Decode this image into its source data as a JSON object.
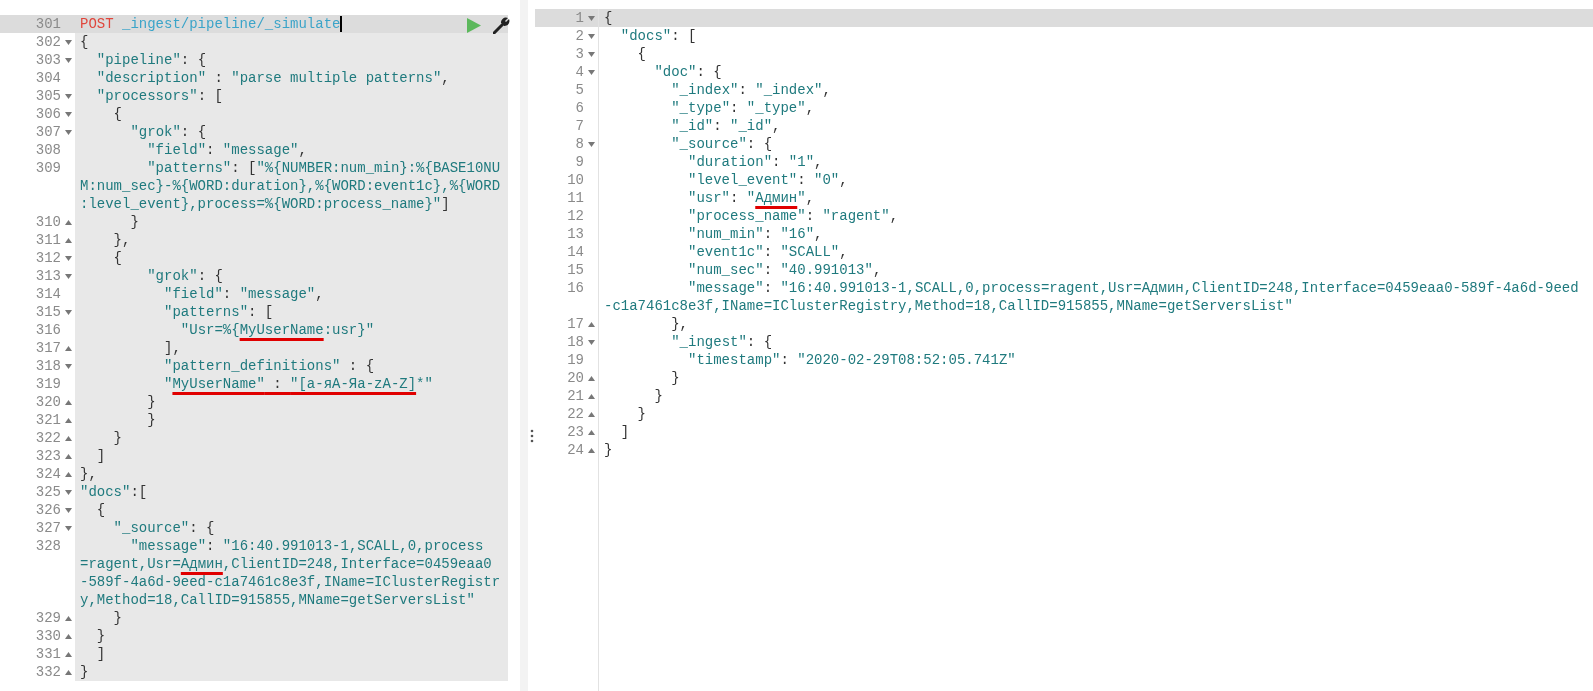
{
  "request_pane": {
    "lines": [
      {
        "number": "301",
        "kind": "request",
        "fold_start": false,
        "fold_end": false,
        "active": true,
        "method": "POST",
        "path": "_ingest/pipeline/_simulate"
      },
      {
        "number": "302",
        "kind": "code",
        "fold_start": true,
        "fold_end": false,
        "active": false,
        "rows": [
          "{"
        ]
      },
      {
        "number": "303",
        "kind": "code",
        "fold_start": true,
        "fold_end": false,
        "active": false,
        "rows": [
          "  \"pipeline\": {"
        ]
      },
      {
        "number": "304",
        "kind": "code",
        "fold_start": false,
        "fold_end": false,
        "active": false,
        "rows": [
          "  \"description\" : \"parse multiple patterns\","
        ]
      },
      {
        "number": "305",
        "kind": "code",
        "fold_start": true,
        "fold_end": false,
        "active": false,
        "rows": [
          "  \"processors\": ["
        ]
      },
      {
        "number": "306",
        "kind": "code",
        "fold_start": true,
        "fold_end": false,
        "active": false,
        "rows": [
          "    {"
        ]
      },
      {
        "number": "307",
        "kind": "code",
        "fold_start": true,
        "fold_end": false,
        "active": false,
        "rows": [
          "      \"grok\": {"
        ]
      },
      {
        "number": "308",
        "kind": "code",
        "fold_start": false,
        "fold_end": false,
        "active": false,
        "rows": [
          "        \"field\": \"message\","
        ]
      },
      {
        "number": "309",
        "kind": "code",
        "fold_start": false,
        "fold_end": false,
        "active": false,
        "rows": [
          "        \"patterns\": [\"%{NUMBER:num_min}:%{BASE10NU",
          "M:num_sec}-%{WORD:duration},%{WORD:event1c},%{WORD",
          ":level_event},process=%{WORD:process_name}\"]"
        ]
      },
      {
        "number": "310",
        "kind": "code",
        "fold_start": false,
        "fold_end": true,
        "active": false,
        "rows": [
          "      }"
        ]
      },
      {
        "number": "311",
        "kind": "code",
        "fold_start": false,
        "fold_end": true,
        "active": false,
        "rows": [
          "    },"
        ]
      },
      {
        "number": "312",
        "kind": "code",
        "fold_start": true,
        "fold_end": false,
        "active": false,
        "rows": [
          "    {"
        ]
      },
      {
        "number": "313",
        "kind": "code",
        "fold_start": true,
        "fold_end": false,
        "active": false,
        "rows": [
          "        \"grok\": {"
        ]
      },
      {
        "number": "314",
        "kind": "code",
        "fold_start": false,
        "fold_end": false,
        "active": false,
        "rows": [
          "          \"field\": \"message\","
        ]
      },
      {
        "number": "315",
        "kind": "code",
        "fold_start": true,
        "fold_end": false,
        "active": false,
        "rows": [
          "          \"patterns\": ["
        ]
      },
      {
        "number": "316",
        "kind": "code",
        "fold_start": false,
        "fold_end": false,
        "active": false,
        "rows": [
          [
            {
              "text": "            \"Usr=%{",
              "underlined": false
            },
            {
              "text": "MyUserName",
              "underlined": true
            },
            {
              "text": ":usr}\"",
              "underlined": false
            }
          ]
        ]
      },
      {
        "number": "317",
        "kind": "code",
        "fold_start": false,
        "fold_end": true,
        "active": false,
        "rows": [
          "          ],"
        ]
      },
      {
        "number": "318",
        "kind": "code",
        "fold_start": true,
        "fold_end": false,
        "active": false,
        "rows": [
          "          \"pattern_definitions\" : {"
        ]
      },
      {
        "number": "319",
        "kind": "code",
        "fold_start": false,
        "fold_end": false,
        "active": false,
        "rows": [
          [
            {
              "text": "          \"",
              "underlined": false
            },
            {
              "text": "MyUserName\" : \"[а-яА-Яа-zA-Z]",
              "underlined": true
            },
            {
              "text": "*\"",
              "underlined": false
            }
          ]
        ]
      },
      {
        "number": "320",
        "kind": "code",
        "fold_start": false,
        "fold_end": true,
        "active": false,
        "rows": [
          "        }"
        ]
      },
      {
        "number": "321",
        "kind": "code",
        "fold_start": false,
        "fold_end": true,
        "active": false,
        "rows": [
          "        }"
        ]
      },
      {
        "number": "322",
        "kind": "code",
        "fold_start": false,
        "fold_end": true,
        "active": false,
        "rows": [
          "    }"
        ]
      },
      {
        "number": "323",
        "kind": "code",
        "fold_start": false,
        "fold_end": true,
        "active": false,
        "rows": [
          "  ]"
        ]
      },
      {
        "number": "324",
        "kind": "code",
        "fold_start": false,
        "fold_end": true,
        "active": false,
        "rows": [
          "},"
        ]
      },
      {
        "number": "325",
        "kind": "code",
        "fold_start": true,
        "fold_end": false,
        "active": false,
        "rows": [
          "\"docs\":["
        ]
      },
      {
        "number": "326",
        "kind": "code",
        "fold_start": true,
        "fold_end": false,
        "active": false,
        "rows": [
          "  {"
        ]
      },
      {
        "number": "327",
        "kind": "code",
        "fold_start": true,
        "fold_end": false,
        "active": false,
        "rows": [
          "    \"_source\": {"
        ]
      },
      {
        "number": "328",
        "kind": "code",
        "fold_start": false,
        "fold_end": false,
        "active": false,
        "rows": [
          "      \"message\": \"16:40.991013-1,SCALL,0,process",
          [
            {
              "text": "=ragent,Usr=",
              "underlined": false
            },
            {
              "text": "Админ",
              "underlined": true
            },
            {
              "text": ",ClientID=248,Interface=0459eaa0",
              "underlined": false
            }
          ],
          "-589f-4a6d-9eed-c1a7461c8e3f,IName=IClusterRegistr",
          "y,Method=18,CallID=915855,MName=getServersList\""
        ]
      },
      {
        "number": "329",
        "kind": "code",
        "fold_start": false,
        "fold_end": true,
        "active": false,
        "rows": [
          "    }"
        ]
      },
      {
        "number": "330",
        "kind": "code",
        "fold_start": false,
        "fold_end": true,
        "active": false,
        "rows": [
          "  }"
        ]
      },
      {
        "number": "331",
        "kind": "code",
        "fold_start": false,
        "fold_end": true,
        "active": false,
        "rows": [
          "  ]"
        ]
      },
      {
        "number": "332",
        "kind": "code",
        "fold_start": false,
        "fold_end": true,
        "active": false,
        "rows": [
          "}"
        ]
      }
    ]
  },
  "response_pane": {
    "lines": [
      {
        "number": "1",
        "kind": "code",
        "fold_start": true,
        "fold_end": false,
        "active": true,
        "rows": [
          "{"
        ]
      },
      {
        "number": "2",
        "kind": "code",
        "fold_start": true,
        "fold_end": false,
        "active": false,
        "rows": [
          "  \"docs\": ["
        ]
      },
      {
        "number": "3",
        "kind": "code",
        "fold_start": true,
        "fold_end": false,
        "active": false,
        "rows": [
          "    {"
        ]
      },
      {
        "number": "4",
        "kind": "code",
        "fold_start": true,
        "fold_end": false,
        "active": false,
        "rows": [
          "      \"doc\": {"
        ]
      },
      {
        "number": "5",
        "kind": "code",
        "fold_start": false,
        "fold_end": false,
        "active": false,
        "rows": [
          "        \"_index\": \"_index\","
        ]
      },
      {
        "number": "6",
        "kind": "code",
        "fold_start": false,
        "fold_end": false,
        "active": false,
        "rows": [
          "        \"_type\": \"_type\","
        ]
      },
      {
        "number": "7",
        "kind": "code",
        "fold_start": false,
        "fold_end": false,
        "active": false,
        "rows": [
          "        \"_id\": \"_id\","
        ]
      },
      {
        "number": "8",
        "kind": "code",
        "fold_start": true,
        "fold_end": false,
        "active": false,
        "rows": [
          "        \"_source\": {"
        ]
      },
      {
        "number": "9",
        "kind": "code",
        "fold_start": false,
        "fold_end": false,
        "active": false,
        "rows": [
          "          \"duration\": \"1\","
        ]
      },
      {
        "number": "10",
        "kind": "code",
        "fold_start": false,
        "fold_end": false,
        "active": false,
        "rows": [
          "          \"level_event\": \"0\","
        ]
      },
      {
        "number": "11",
        "kind": "code",
        "fold_start": false,
        "fold_end": false,
        "active": false,
        "rows": [
          [
            {
              "text": "          \"usr\": \"",
              "underlined": false
            },
            {
              "text": "Админ",
              "underlined": true
            },
            {
              "text": "\",",
              "underlined": false
            }
          ]
        ]
      },
      {
        "number": "12",
        "kind": "code",
        "fold_start": false,
        "fold_end": false,
        "active": false,
        "rows": [
          "          \"process_name\": \"ragent\","
        ]
      },
      {
        "number": "13",
        "kind": "code",
        "fold_start": false,
        "fold_end": false,
        "active": false,
        "rows": [
          "          \"num_min\": \"16\","
        ]
      },
      {
        "number": "14",
        "kind": "code",
        "fold_start": false,
        "fold_end": false,
        "active": false,
        "rows": [
          "          \"event1c\": \"SCALL\","
        ]
      },
      {
        "number": "15",
        "kind": "code",
        "fold_start": false,
        "fold_end": false,
        "active": false,
        "rows": [
          "          \"num_sec\": \"40.991013\","
        ]
      },
      {
        "number": "16",
        "kind": "code",
        "fold_start": false,
        "fold_end": false,
        "active": false,
        "rows": [
          "          \"message\": \"16:40.991013-1,SCALL,0,process=ragent,Usr=Админ,ClientID=248,Interface=0459eaa0-589f-4a6d-9eed",
          "-c1a7461c8e3f,IName=IClusterRegistry,Method=18,CallID=915855,MName=getServersList\""
        ]
      },
      {
        "number": "17",
        "kind": "code",
        "fold_start": false,
        "fold_end": true,
        "active": false,
        "rows": [
          "        },"
        ]
      },
      {
        "number": "18",
        "kind": "code",
        "fold_start": true,
        "fold_end": false,
        "active": false,
        "rows": [
          "        \"_ingest\": {"
        ]
      },
      {
        "number": "19",
        "kind": "code",
        "fold_start": false,
        "fold_end": false,
        "active": false,
        "rows": [
          "          \"timestamp\": \"2020-02-29T08:52:05.741Z\""
        ]
      },
      {
        "number": "20",
        "kind": "code",
        "fold_start": false,
        "fold_end": true,
        "active": false,
        "rows": [
          "        }"
        ]
      },
      {
        "number": "21",
        "kind": "code",
        "fold_start": false,
        "fold_end": true,
        "active": false,
        "rows": [
          "      }"
        ]
      },
      {
        "number": "22",
        "kind": "code",
        "fold_start": false,
        "fold_end": true,
        "active": false,
        "rows": [
          "    }"
        ]
      },
      {
        "number": "23",
        "kind": "code",
        "fold_start": false,
        "fold_end": true,
        "active": false,
        "rows": [
          "  ]"
        ]
      },
      {
        "number": "24",
        "kind": "code",
        "fold_start": false,
        "fold_end": true,
        "active": false,
        "rows": [
          "}"
        ]
      }
    ]
  }
}
